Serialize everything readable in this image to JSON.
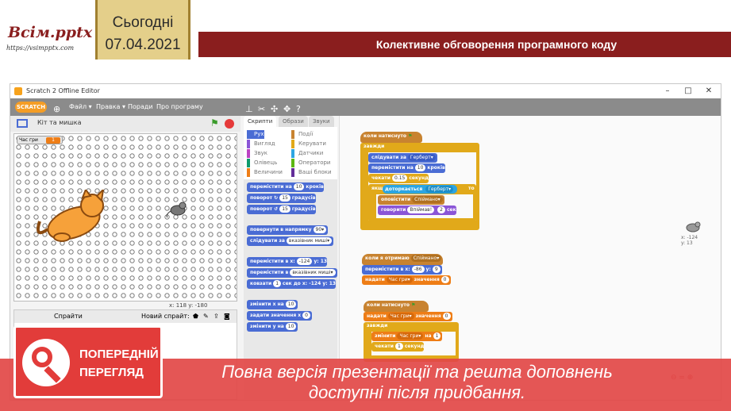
{
  "header": {
    "logo_text": "Всім.pptx",
    "logo_url": "https://vsimpptx.com",
    "date_label": "Сьогодні",
    "date": "07.04.2021",
    "slide_title": "Колективне обговорення програмного коду"
  },
  "window": {
    "title": "Scratch 2 Offline Editor",
    "controls": [
      "–",
      "□",
      "✕"
    ]
  },
  "menu": {
    "logo": "SCRATCH",
    "items": [
      "Файл ▾",
      "Правка ▾",
      "Поради",
      "Про програму"
    ]
  },
  "stage": {
    "project_name": "Кіт та мишка",
    "variable_label": "Час гри",
    "variable_value": "1",
    "coords": "x: 118  y: -180"
  },
  "sprites_panel": {
    "label": "Спрайти",
    "new_sprite": "Новий спрайт:"
  },
  "tabs": [
    "Скрипти",
    "Образи",
    "Звуки"
  ],
  "categories": [
    {
      "name": "Рух",
      "color": "#4a6cd4"
    },
    {
      "name": "Вигляд",
      "color": "#8a55d7"
    },
    {
      "name": "Звук",
      "color": "#bb42c3"
    },
    {
      "name": "Олівець",
      "color": "#0e9a6c"
    },
    {
      "name": "Величини",
      "color": "#ee7d16"
    },
    {
      "name": "Події",
      "color": "#c88330"
    },
    {
      "name": "Керувати",
      "color": "#e1a91a"
    },
    {
      "name": "Датчики",
      "color": "#2ca5e2"
    },
    {
      "name": "Оператори",
      "color": "#5cb712"
    },
    {
      "name": "Ваші блоки",
      "color": "#632d99"
    }
  ],
  "palette_blocks": [
    {
      "pre": "перемістити на",
      "val": "10",
      "post": "кроків"
    },
    {
      "pre": "поворот ↻",
      "val": "15",
      "post": "градусів"
    },
    {
      "pre": "поворот ↺",
      "val": "15",
      "post": "градусів"
    },
    {
      "pre": "повернути в напрямку",
      "val": "90▾",
      "post": ""
    },
    {
      "pre": "слідувати за",
      "val": "вказівник миші▾",
      "post": ""
    },
    {
      "pre": "перемістити в x:",
      "val": "-124",
      "post": "y: 13"
    },
    {
      "pre": "перемістити в",
      "val": "вказівник миші▾",
      "post": ""
    },
    {
      "pre": "ковзати",
      "val": "1",
      "post": "сек до x: -124 y: 13"
    },
    {
      "pre": "змінити x на",
      "val": "10",
      "post": ""
    },
    {
      "pre": "задати значення x",
      "val": "0",
      "post": ""
    },
    {
      "pre": "змінити у на",
      "val": "10",
      "post": ""
    }
  ],
  "scripts": {
    "s1": {
      "hat": "коли натиснуто",
      "forever": "завжди",
      "follow": "слідувати за",
      "follow_val": "Герберт▾",
      "move": "перемістити на",
      "move_val": "10",
      "move_post": "кроків",
      "wait": "чекати",
      "wait_val": "0.15",
      "wait_post": "секунд",
      "if": "якщо",
      "touching": "доторкається",
      "touching_val": "Герберт▾",
      "then": "то",
      "broadcast": "оповістити",
      "broadcast_val": "Спіймано▾",
      "say": "говорити",
      "say_val": "Впіймав!",
      "say_n": "2",
      "say_post": "сек"
    },
    "s2": {
      "hat": "коли я отримаю",
      "hat_val": "Спіймано▾",
      "goto": "перемістити в x:",
      "x": "-86",
      "y_label": "y:",
      "y": "9",
      "set": "надати",
      "set_var": "Час гри▾",
      "set_mid": "значення",
      "set_val": "0"
    },
    "s3": {
      "hat": "коли натиснуто",
      "set": "надати",
      "set_var": "Час гри▾",
      "set_mid": "значення",
      "set_val": "0",
      "forever": "завжди",
      "change": "змінити",
      "change_var": "Час гри▾",
      "change_mid": "на",
      "change_val": "1",
      "wait": "чекати",
      "wait_val": "1",
      "wait_post": "секунд"
    }
  },
  "sprite_info": {
    "x": "x: -124",
    "y": "y: 13"
  },
  "zoom": "⊖ = ⊕",
  "overlay": {
    "preview_line1": "ПОПЕРЕДНІЙ",
    "preview_line2": "ПЕРЕГЛЯД",
    "notice_line1": "Повна версія презентації та решта доповнень",
    "notice_line2": "доступні після придбання."
  },
  "colors": {
    "accent": "#8a1e1e",
    "date_bg": "#e4cf8a",
    "banner": "#e24846"
  }
}
